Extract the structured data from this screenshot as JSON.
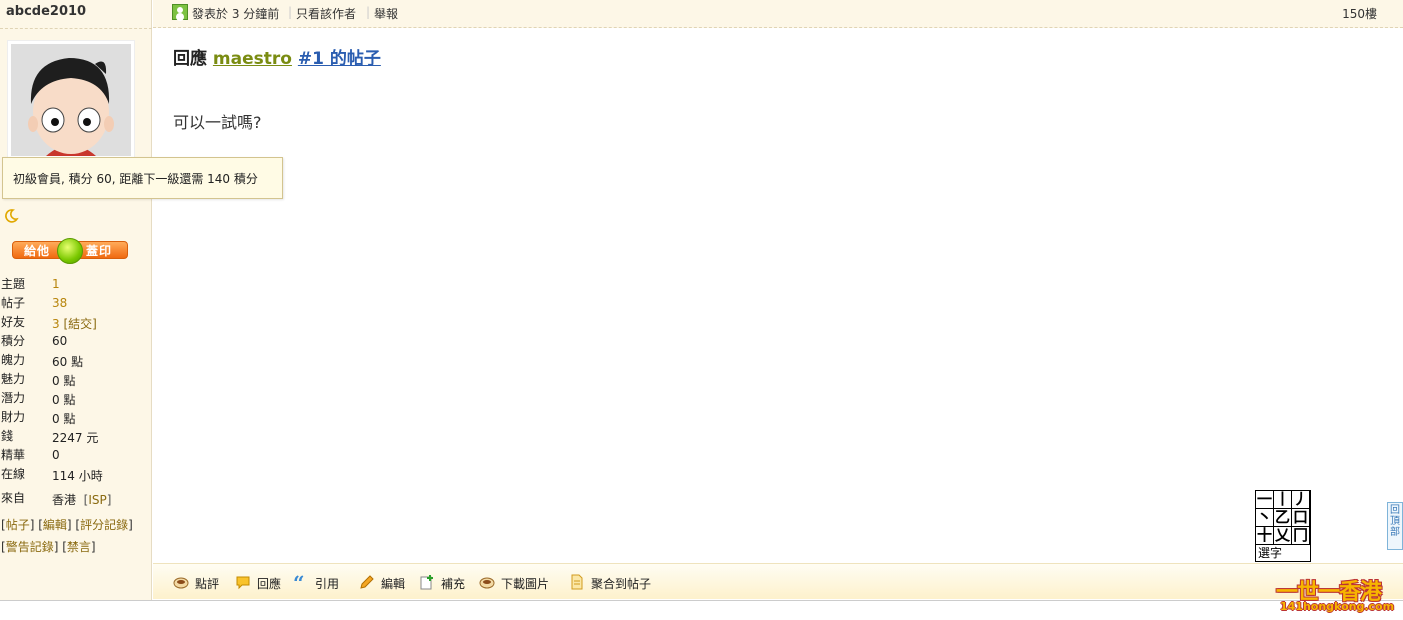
{
  "sidebar": {
    "username": "abcde2010",
    "stamp": {
      "left": "給他",
      "right": "蓋印"
    },
    "stats": [
      {
        "label": "主題",
        "value": "1",
        "link": true
      },
      {
        "label": "帖子",
        "value": "38",
        "link": true
      },
      {
        "label": "好友",
        "value": "3",
        "link_text": "[結交]"
      },
      {
        "label": "積分",
        "value": "60"
      },
      {
        "label": "魄力",
        "value": "60 點"
      },
      {
        "label": "魅力",
        "value": "0 點"
      },
      {
        "label": "潛力",
        "value": "0 點"
      },
      {
        "label": "財力",
        "value": "0 點"
      },
      {
        "label": "錢",
        "value": "2247 元"
      },
      {
        "label": "精華",
        "value": "0"
      },
      {
        "label": "在線",
        "value": "114 小時"
      }
    ],
    "from": {
      "label": "來自",
      "value": "香港",
      "isp": "ISP"
    },
    "links1": [
      "帖子",
      "編輯",
      "評分記錄"
    ],
    "links2": [
      "警告記錄",
      "禁言"
    ]
  },
  "tooltip": "初級會員, 積分 60, 距離下一級還需 140 積分",
  "topbar": {
    "posted": "發表於 3 分鐘前",
    "only_author": "只看該作者",
    "report": "舉報",
    "floor": "150樓"
  },
  "post": {
    "title_prefix": "回應",
    "author": "maestro",
    "post_ref": "#1 的帖子",
    "body": "可以一試嗎?"
  },
  "ime": {
    "cells": [
      "一",
      "丨",
      "丿",
      "丶",
      "乙",
      "口",
      "十",
      "乂",
      "冂"
    ],
    "footer": "選字"
  },
  "back_to_top": "回頂部",
  "actions": [
    {
      "label": "點評",
      "icon": "comment-cup-icon"
    },
    {
      "label": "回應",
      "icon": "reply-bubble-icon"
    },
    {
      "label": "引用",
      "icon": "quote-icon"
    },
    {
      "label": "編輯",
      "icon": "pencil-icon"
    },
    {
      "label": "補充",
      "icon": "add-note-icon"
    },
    {
      "label": "下載圖片",
      "icon": "download-cup-icon"
    },
    {
      "label": "聚合到帖子",
      "icon": "document-icon"
    }
  ],
  "logo": {
    "main": "一世一香港",
    "sub": "141hongkong.com"
  },
  "colors": {
    "sidebar_bg": "#fdf7e7",
    "accent": "#f06a10",
    "link": "#b7850c"
  }
}
